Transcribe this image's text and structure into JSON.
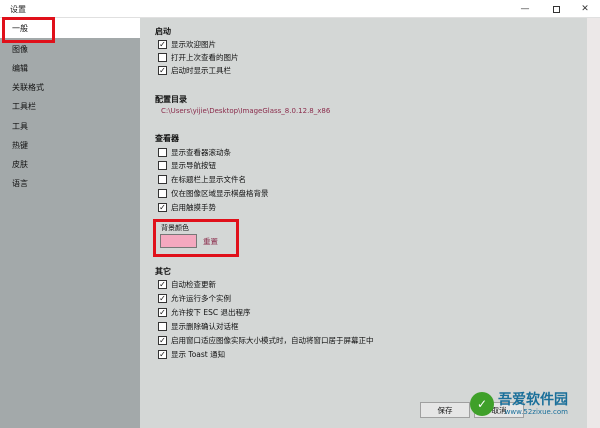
{
  "window": {
    "title": "设置",
    "min_glyph": "—",
    "close_glyph": "✕"
  },
  "sidebar": {
    "items": [
      {
        "label": "一般",
        "selected": true
      },
      {
        "label": "图像"
      },
      {
        "label": "编辑"
      },
      {
        "label": "关联格式"
      },
      {
        "label": "工具栏"
      },
      {
        "label": "工具"
      },
      {
        "label": "热键"
      },
      {
        "label": "皮肤"
      },
      {
        "label": "语言"
      }
    ]
  },
  "startup": {
    "title": "启动",
    "options": [
      {
        "label": "显示欢迎图片",
        "checked": true
      },
      {
        "label": "打开上次查看的图片",
        "checked": false
      },
      {
        "label": "启动时显示工具栏",
        "checked": true
      }
    ]
  },
  "config_dir": {
    "title": "配置目录",
    "path": "C:\\Users\\yijie\\Desktop\\ImageGlass_8.0.12.8_x86"
  },
  "viewer": {
    "title": "查看器",
    "options": [
      {
        "label": "显示查看器滚动条",
        "checked": false
      },
      {
        "label": "显示导航按钮",
        "checked": false
      },
      {
        "label": "在标题栏上显示文件名",
        "checked": false
      },
      {
        "label": "仅在图像区域显示棋盘格背景",
        "checked": false
      },
      {
        "label": "启用触摸手势",
        "checked": true
      }
    ],
    "background": {
      "label": "背景颜色",
      "color": "#f4a8bf",
      "reset_label": "重置"
    }
  },
  "other": {
    "title": "其它",
    "options": [
      {
        "label": "自动检查更新",
        "checked": true
      },
      {
        "label": "允许运行多个实例",
        "checked": true
      },
      {
        "label": "允许按下 ESC 退出程序",
        "checked": true
      },
      {
        "label": "显示删除确认对话框",
        "checked": false
      },
      {
        "label": "启用窗口适应图像实际大小模式时，自动将窗口居于屏幕正中",
        "checked": true
      },
      {
        "label": "显示 Toast 通知",
        "checked": true
      }
    ]
  },
  "footer": {
    "save_label": "保存",
    "cancel_label": "取消"
  },
  "watermark": {
    "main": "吾爱软件园",
    "sub": "www.52zixue.com",
    "logo_glyph": "✓"
  },
  "check_glyph": "✓"
}
